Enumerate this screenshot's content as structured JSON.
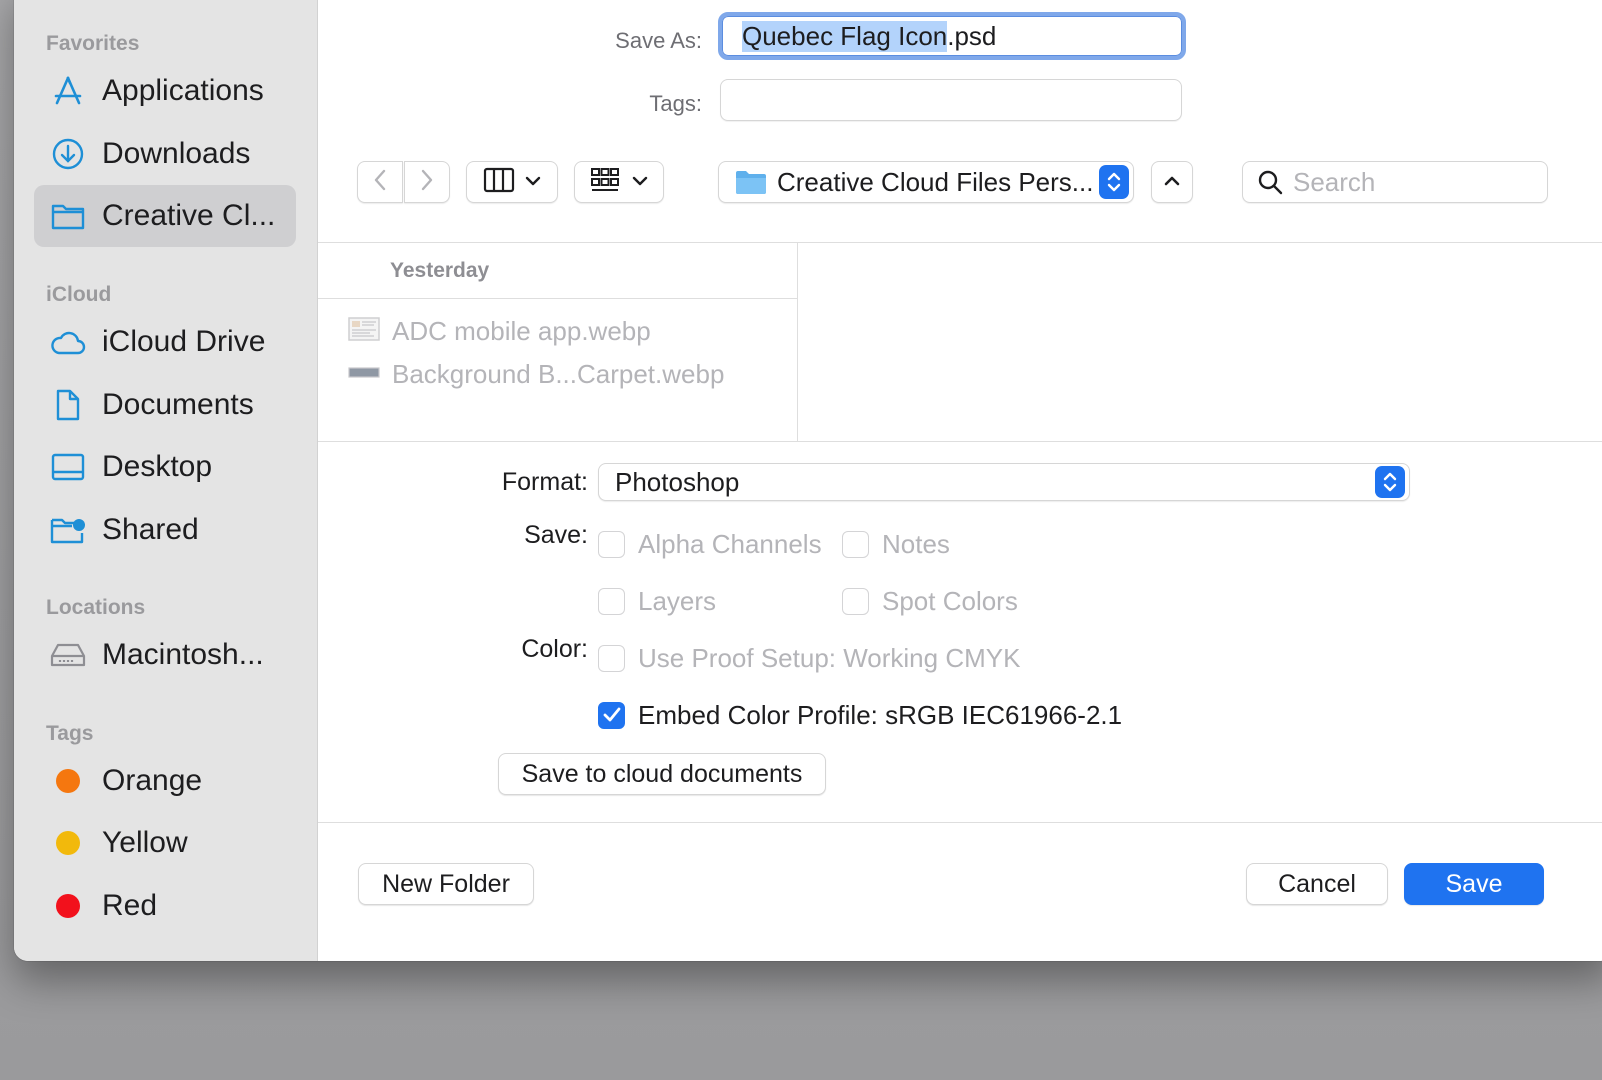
{
  "sidebar": {
    "sections": {
      "favorites": "Favorites",
      "icloud": "iCloud",
      "locations": "Locations",
      "tags": "Tags"
    },
    "favorites": [
      {
        "label": "Applications",
        "icon": "applications-icon"
      },
      {
        "label": "Downloads",
        "icon": "downloads-icon"
      },
      {
        "label": "Creative Cl...",
        "icon": "folder-icon",
        "selected": true
      }
    ],
    "icloud": [
      {
        "label": "iCloud Drive",
        "icon": "cloud-icon"
      },
      {
        "label": "Documents",
        "icon": "document-icon"
      },
      {
        "label": "Desktop",
        "icon": "desktop-icon"
      },
      {
        "label": "Shared",
        "icon": "shared-folder-icon"
      }
    ],
    "locations": [
      {
        "label": "Macintosh...",
        "icon": "hard-drive-icon"
      }
    ],
    "tags": [
      {
        "label": "Orange",
        "color": "#f5770f"
      },
      {
        "label": "Yellow",
        "color": "#f2b90c"
      },
      {
        "label": "Red",
        "color": "#f2111c"
      }
    ]
  },
  "header": {
    "save_as_label": "Save As:",
    "filename_selected": "Quebec Flag Icon",
    "filename_ext": ".psd",
    "tags_label": "Tags:"
  },
  "toolbar": {
    "location": "Creative Cloud Files Pers...",
    "search_placeholder": "Search"
  },
  "browser": {
    "group_header": "Yesterday",
    "files": [
      {
        "name": "ADC mobile app.webp"
      },
      {
        "name": "Background B...Carpet.webp"
      }
    ]
  },
  "options": {
    "format_label": "Format:",
    "format_value": "Photoshop",
    "save_label": "Save:",
    "alpha_channels": "Alpha Channels",
    "notes": "Notes",
    "layers": "Layers",
    "spot_colors": "Spot Colors",
    "color_label": "Color:",
    "use_proof_setup": "Use Proof Setup:  Working CMYK",
    "embed_color_profile": "Embed Color Profile:  sRGB IEC61966-2.1",
    "embed_checked": true,
    "cloud_button": "Save to cloud documents"
  },
  "footer": {
    "new_folder": "New Folder",
    "cancel": "Cancel",
    "save": "Save"
  },
  "colors": {
    "accent": "#1f73f0",
    "sidebar_icon": "#1e8fd6",
    "selection": "#b3d3fb"
  }
}
